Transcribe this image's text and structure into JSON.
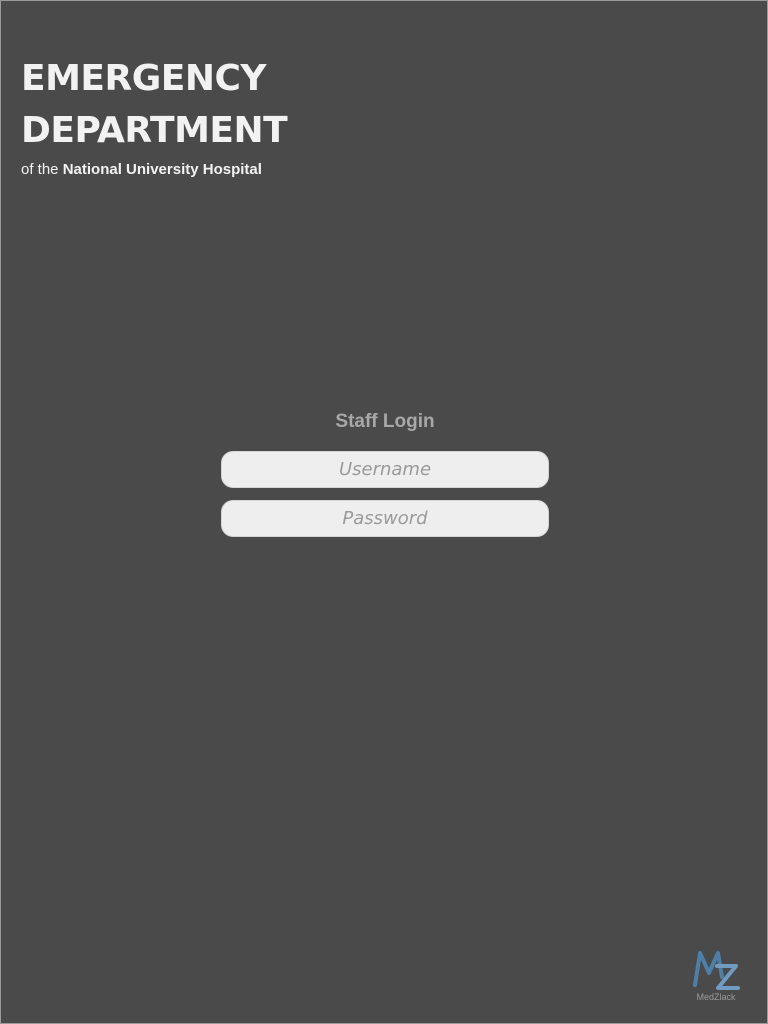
{
  "brand": {
    "title_line1": "EMERGENCY",
    "title_line2": "DEPARTMENT",
    "subtitle_prefix": "of the",
    "subtitle_hospital": "National University Hospital"
  },
  "login": {
    "title": "Staff Login",
    "username": {
      "value": "",
      "placeholder": "Username"
    },
    "password": {
      "value": "",
      "placeholder": "Password"
    }
  },
  "footer_logo": {
    "icon": "medzlack-logo-icon",
    "text": "MedZlack",
    "colors": {
      "m": "#4e7fa6",
      "z": "#6f9cc0"
    }
  },
  "colors": {
    "background": "#4a4a4a",
    "title_text": "#f2f2f2",
    "login_title": "#a8a8a8",
    "input_background": "#eeeeee",
    "placeholder": "#9a9a9a"
  }
}
